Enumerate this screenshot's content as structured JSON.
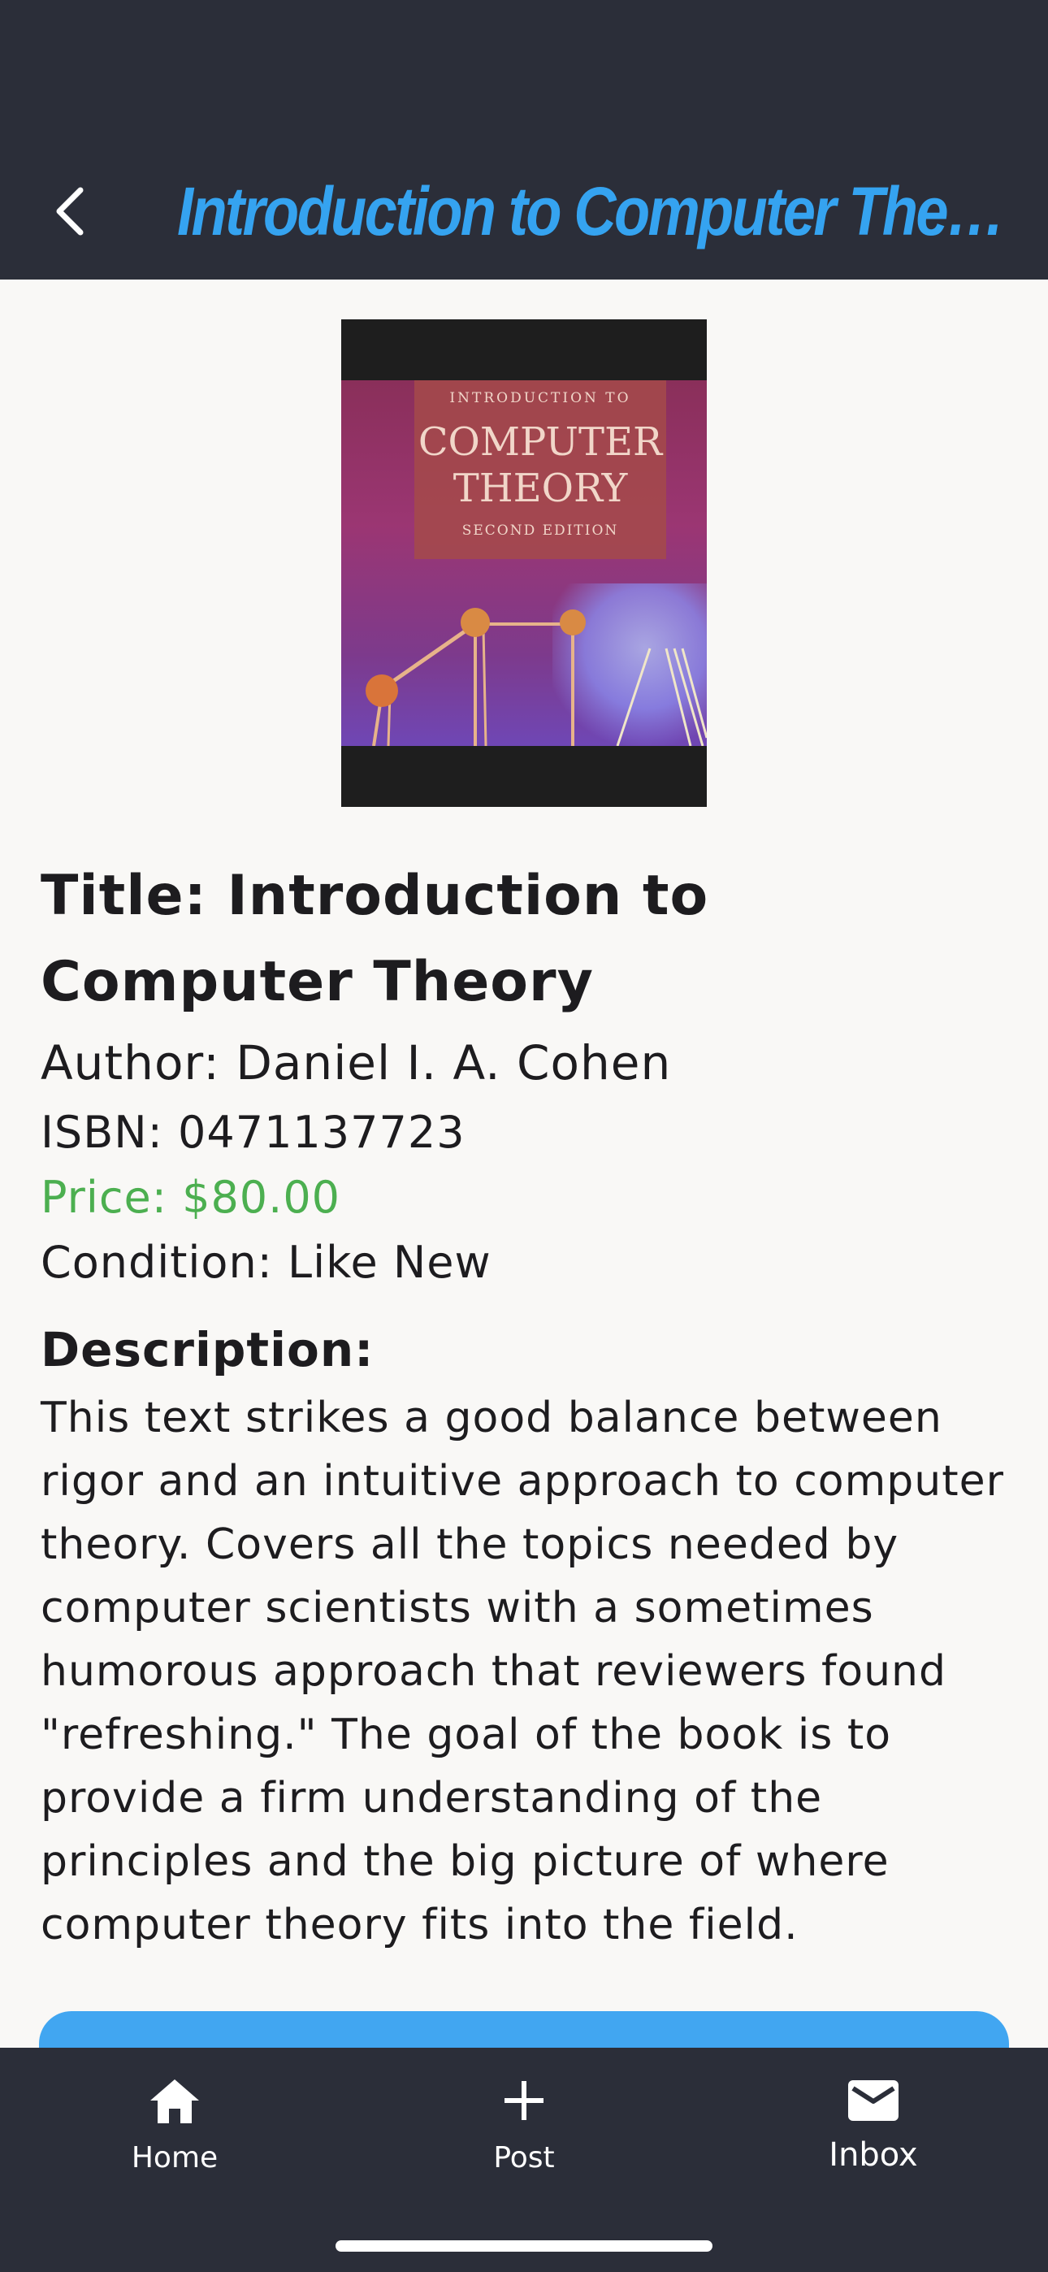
{
  "header": {
    "title": "Introduction to Computer Theory",
    "back_icon": "chevron-left-icon"
  },
  "cover": {
    "line1": "INTRODUCTION TO",
    "line2": "COMPUTER",
    "line3": "THEORY",
    "line4": "SECOND EDITION"
  },
  "book": {
    "title": "Title: Introduction to Computer Theory",
    "author": "Author: Daniel I. A. Cohen",
    "isbn": "ISBN: 0471137723",
    "price": "Price: $80.00",
    "condition": "Condition: Like New",
    "description_heading": "Description:",
    "description": "This text strikes a good balance between rigor and an intuitive approach to computer theory. Covers all the topics needed by computer scientists with a sometimes humorous approach that reviewers found \"refreshing.\" The goal of the book is to provide a firm understanding of the principles and the big picture of where computer theory fits into the field."
  },
  "nav": {
    "home_label": "Home",
    "post_label": "Post",
    "inbox_label": "Inbox"
  },
  "colors": {
    "bar_background": "#2b2e39",
    "accent": "#35a3f0",
    "price": "#4caf50",
    "page_background": "#f9f8f6"
  }
}
